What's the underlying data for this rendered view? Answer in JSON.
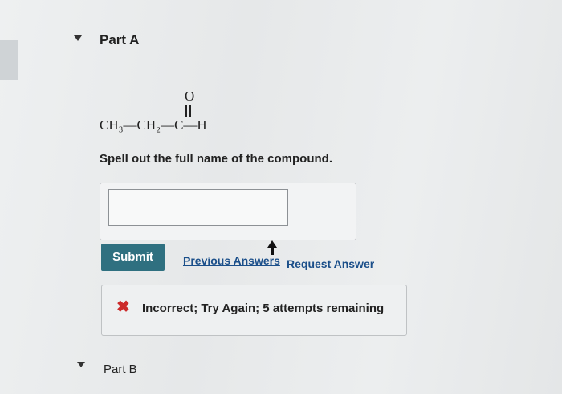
{
  "part_a": {
    "label": "Part A",
    "formula": {
      "main": "CH₃—CH₂—C—H",
      "oxygen": "O"
    },
    "question": "Spell out the full name of the compound.",
    "answer": {
      "value": "",
      "placeholder": ""
    },
    "submit_label": "Submit",
    "previous_answers_label": "Previous Answers",
    "request_answer_label": "Request Answer",
    "feedback": {
      "icon": "x-icon",
      "message": "Incorrect; Try Again; 5 attempts remaining",
      "color": "#cc2b2b"
    }
  },
  "part_b": {
    "label": "Part B"
  }
}
